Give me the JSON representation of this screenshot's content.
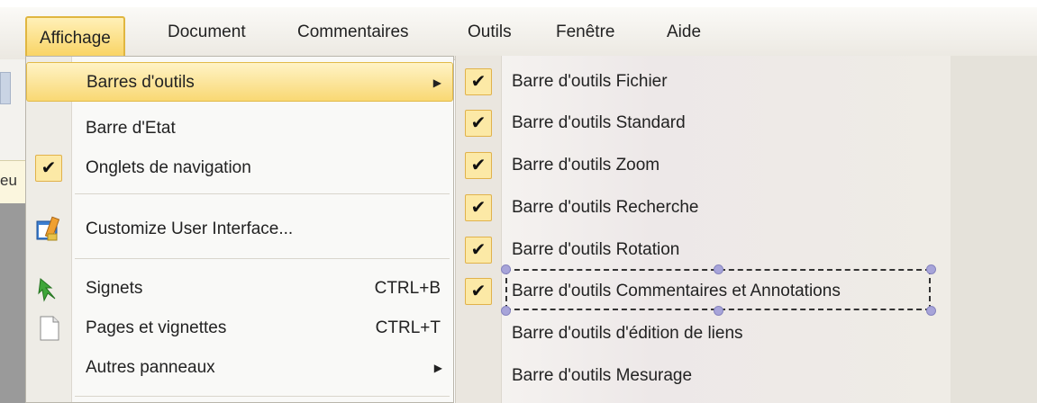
{
  "menubar": {
    "items": [
      {
        "label": "Affichage"
      },
      {
        "label": "Document"
      },
      {
        "label": "Commentaires"
      },
      {
        "label": "Outils"
      },
      {
        "label": "Fenêtre"
      },
      {
        "label": "Aide"
      }
    ]
  },
  "background_app": {
    "partial_text": "eu"
  },
  "view_menu": {
    "items": [
      {
        "label": "Barres d'outils",
        "has_submenu": true,
        "highlighted": true
      },
      {
        "label": "Barre d'Etat"
      },
      {
        "label": "Onglets de navigation",
        "checked": true
      },
      {
        "label": "Customize User Interface...",
        "icon": "customize-ui-icon"
      },
      {
        "label": "Signets",
        "shortcut": "CTRL+B",
        "icon": "bookmark-icon"
      },
      {
        "label": "Pages et vignettes",
        "shortcut": "CTRL+T",
        "icon": "page-icon"
      },
      {
        "label": "Autres panneaux",
        "has_submenu": true
      }
    ]
  },
  "toolbars_submenu": {
    "items": [
      {
        "label": "Barre d'outils Fichier",
        "checked": true
      },
      {
        "label": "Barre d'outils Standard",
        "checked": true
      },
      {
        "label": "Barre d'outils Zoom",
        "checked": true
      },
      {
        "label": "Barre d'outils Recherche",
        "checked": true
      },
      {
        "label": "Barre d'outils Rotation",
        "checked": true
      },
      {
        "label": "Barre d'outils Commentaires et Annotations",
        "checked": true,
        "selected": true
      },
      {
        "label": "Barre d'outils d'édition de liens",
        "checked": false
      },
      {
        "label": "Barre d'outils Mesurage",
        "checked": false
      }
    ]
  },
  "icons": {
    "check": "✔",
    "submenu_arrow": "▶"
  },
  "colors": {
    "highlight": "#f9d873",
    "check_bg": "#fce9a6",
    "selection_handle": "#a7a4d9"
  }
}
